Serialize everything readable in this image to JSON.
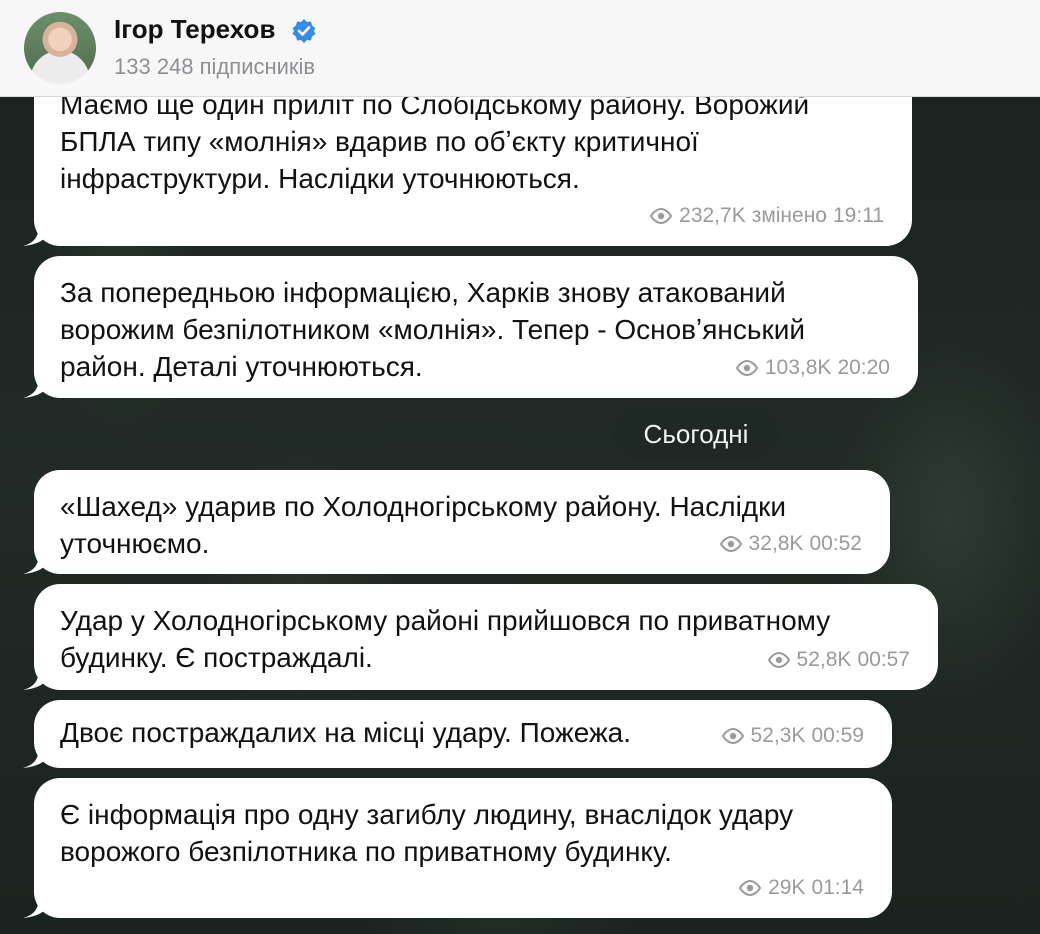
{
  "channel": {
    "name": "Ігор Терехов",
    "subscribers": "133 248 підписників"
  },
  "date_separator": "Сьогодні",
  "messages": [
    {
      "text": "Маємо ще один приліт по Слобідському району. Ворожий\nБПЛА типу «молнія» вдарив по обʼєкту критичної\nінфраструктури. Наслідки уточнюються.",
      "views": "232,7K",
      "edited": "змінено",
      "time": "19:11"
    },
    {
      "text": "За попередньою інформацією, Харків знову атакований\nворожим безпілотником «молнія». Тепер - Основʼянський\nрайон. Деталі уточнюються.",
      "views": "103,8K",
      "time": "20:20"
    },
    {
      "text": "«Шахед» ударив по Холодногірському району. Наслідки\nуточнюємо.",
      "views": "32,8K",
      "time": "00:52"
    },
    {
      "text": "Удар у Холодногірському районі прийшовся по приватному\nбудинку. Є постраждалі.",
      "views": "52,8K",
      "time": "00:57"
    },
    {
      "text": "Двоє постраждалих на місці удару. Пожежа.",
      "views": "52,3K",
      "time": "00:59"
    },
    {
      "text": "Є інформація про одну загиблу людину, внаслідок удару\nворожого безпілотника по приватному будинку.",
      "views": "29K",
      "time": "01:14"
    }
  ]
}
